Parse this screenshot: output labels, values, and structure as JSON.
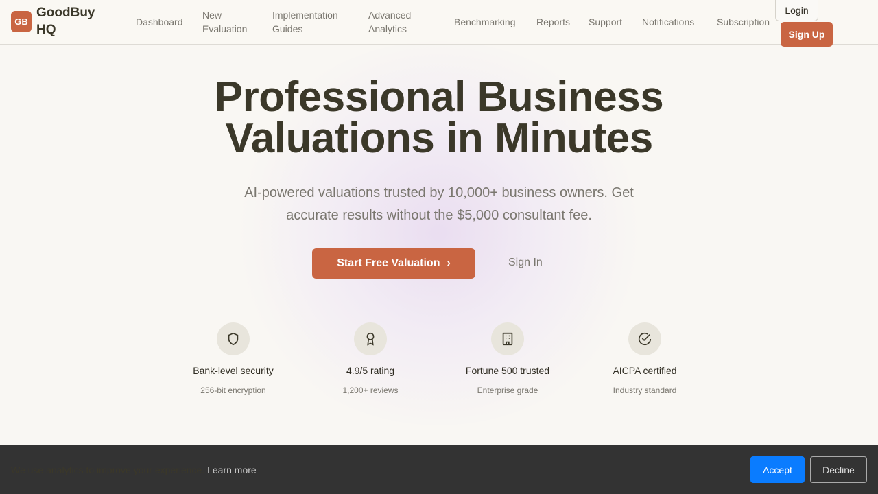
{
  "header": {
    "logo": "GB",
    "brand": "GoodBuy HQ",
    "nav": [
      "Dashboard",
      "New Evaluation",
      "Implementation Guides",
      "Advanced Analytics",
      "Benchmarking",
      "Reports",
      "Support",
      "Notifications",
      "Subscription"
    ],
    "login": "Login",
    "signup": "Sign Up"
  },
  "hero": {
    "title": "Professional Business Valuations in Minutes",
    "subtitle": "AI-powered valuations trusted by 10,000+ business owners. Get accurate results without the $5,000 consultant fee.",
    "cta": "Start Free Valuation",
    "signin": "Sign In"
  },
  "features": [
    {
      "icon": "shield-icon",
      "title": "Bank-level security",
      "sub": "256-bit encryption"
    },
    {
      "icon": "award-icon",
      "title": "4.9/5 rating",
      "sub": "1,200+ reviews"
    },
    {
      "icon": "building-icon",
      "title": "Fortune 500 trusted",
      "sub": "Enterprise grade"
    },
    {
      "icon": "check-circle-icon",
      "title": "AICPA certified",
      "sub": "Industry standard"
    }
  ],
  "cookie": {
    "text": "We use analytics to improve your experience.",
    "learn": "Learn more",
    "accept": "Accept",
    "decline": "Decline"
  },
  "colors": {
    "accent": "#c96542",
    "accept": "#0a7cff"
  }
}
